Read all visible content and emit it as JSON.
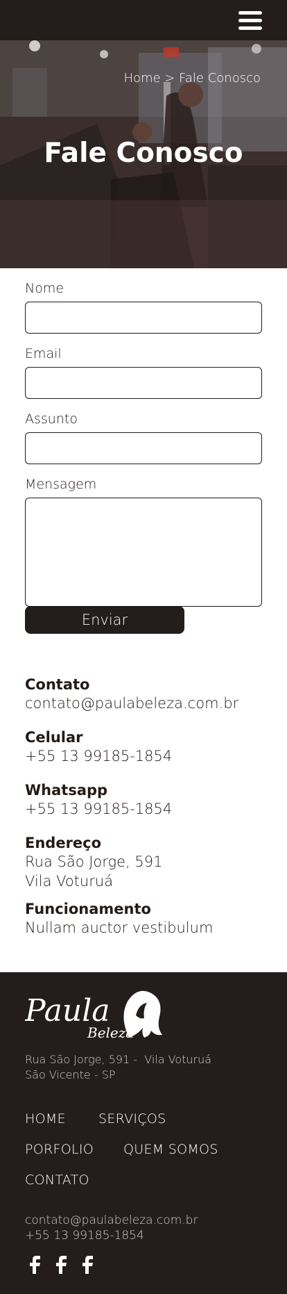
{
  "header": {
    "menu_icon": "hamburger-menu-icon"
  },
  "hero": {
    "breadcrumb": {
      "home": "Home",
      "separator": ">",
      "current": "Fale Conosco"
    },
    "title": "Fale Conosco"
  },
  "form": {
    "name_label": "Nome",
    "email_label": "Email",
    "subject_label": "Assunto",
    "message_label": "Mensagem",
    "submit_label": "Enviar"
  },
  "info": {
    "contact_title": "Contato",
    "contact_value": "contato@paulabeleza.com.br",
    "mobile_title": "Celular",
    "mobile_value": "+55 13 99185-1854",
    "whatsapp_title": "Whatsapp",
    "whatsapp_value": "+55 13 99185-1854",
    "address_title": "Endereço",
    "address_line1": "Rua São Jorge, 591",
    "address_line2": "Vila Voturuá",
    "hours_title": "Funcionamento",
    "hours_value": "Nullam auctor vestibulum"
  },
  "footer": {
    "logo_text": "Paula",
    "logo_subtext": "Beleza",
    "address_line1": "Rua São Jorge, 591 -  Vila Voturuá",
    "address_line2": "São Vicente - SP",
    "nav": {
      "home": "HOME",
      "services": "SERVIÇOS",
      "portfolio": "PORFOLIO",
      "about": "QUEM SOMOS",
      "contact": "CONTATO"
    },
    "email": "contato@paulabeleza.com.br",
    "phone": "+55 13 99185-1854",
    "social_icons": [
      "facebook-icon",
      "facebook-icon",
      "facebook-icon"
    ]
  },
  "colors": {
    "dark": "#231d1c",
    "text": "#231b18",
    "white": "#ffffff"
  }
}
